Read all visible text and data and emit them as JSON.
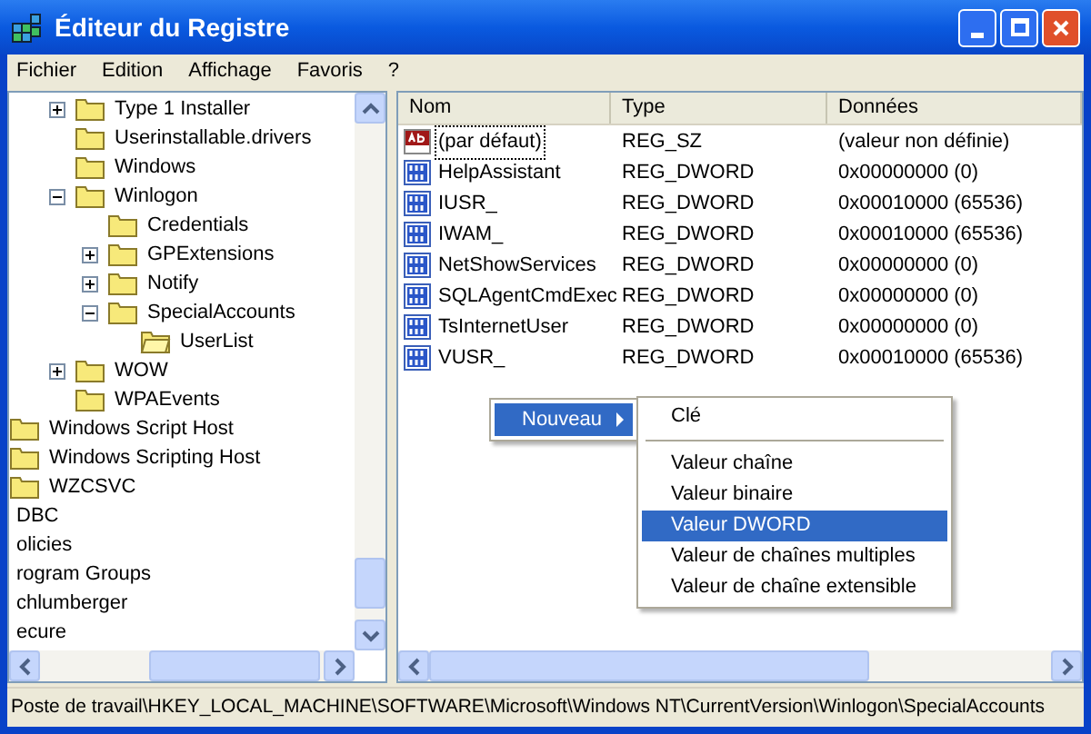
{
  "window": {
    "title": "Éditeur du Registre"
  },
  "menu_bar": [
    "Fichier",
    "Edition",
    "Affichage",
    "Favoris",
    "?"
  ],
  "tree": {
    "nodes": [
      {
        "children": [
          {
            "children": [
              {
                "children": [
                  {
                    "label": "Type 1 Installer",
                    "expanded": false,
                    "selected": false
                  },
                  {
                    "label": "Userinstallable.drivers",
                    "selected": false
                  },
                  {
                    "label": "Windows",
                    "selected": false
                  },
                  {
                    "label": "Winlogon",
                    "expanded": true,
                    "selected": false,
                    "children": [
                      {
                        "label": "Credentials",
                        "selected": false
                      },
                      {
                        "label": "GPExtensions",
                        "expanded": false,
                        "selected": false
                      },
                      {
                        "label": "Notify",
                        "expanded": false,
                        "selected": false
                      },
                      {
                        "label": "SpecialAccounts",
                        "expanded": true,
                        "selected": false,
                        "children": [
                          {
                            "label": "UserList",
                            "selected": true
                          }
                        ]
                      }
                    ]
                  },
                  {
                    "label": "WOW",
                    "expanded": false,
                    "selected": false
                  },
                  {
                    "label": "WPAEvents",
                    "selected": false
                  }
                ]
              }
            ]
          },
          {
            "label": "Windows Script Host",
            "selected": false
          },
          {
            "label": "Windows Scripting Host",
            "selected": false
          },
          {
            "label": "WZCSVC",
            "selected": false
          }
        ]
      },
      {
        "label": "DBC"
      },
      {
        "label": "olicies"
      },
      {
        "label": "rogram Groups"
      },
      {
        "label": "chlumberger"
      },
      {
        "label": "ecure"
      }
    ]
  },
  "values": {
    "columns": [
      "Nom",
      "Type",
      "Données"
    ],
    "rows": [
      {
        "kind": "string",
        "name": "(par défaut)",
        "type": "REG_SZ",
        "data": "(valeur non définie)",
        "focused": true
      },
      {
        "kind": "dword",
        "name": "HelpAssistant",
        "type": "REG_DWORD",
        "data": "0x00000000 (0)",
        "focused": false
      },
      {
        "kind": "dword",
        "name": "IUSR_",
        "type": "REG_DWORD",
        "data": "0x00010000 (65536)",
        "focused": false
      },
      {
        "kind": "dword",
        "name": "IWAM_",
        "type": "REG_DWORD",
        "data": "0x00010000 (65536)",
        "focused": false
      },
      {
        "kind": "dword",
        "name": "NetShowServices",
        "type": "REG_DWORD",
        "data": "0x00000000 (0)",
        "focused": false
      },
      {
        "kind": "dword",
        "name": "SQLAgentCmdExec",
        "type": "REG_DWORD",
        "data": "0x00000000 (0)",
        "focused": false
      },
      {
        "kind": "dword",
        "name": "TsInternetUser",
        "type": "REG_DWORD",
        "data": "0x00000000 (0)",
        "focused": false
      },
      {
        "kind": "dword",
        "name": "VUSR_",
        "type": "REG_DWORD",
        "data": "0x00010000 (65536)",
        "focused": false
      }
    ]
  },
  "context_menu": {
    "items": [
      {
        "label": "Nouveau",
        "selected": true,
        "submenu": true
      }
    ],
    "submenu": [
      {
        "kind": "item",
        "label": "Clé",
        "selected": false
      },
      {
        "kind": "separator"
      },
      {
        "kind": "item",
        "label": "Valeur chaîne",
        "selected": false
      },
      {
        "kind": "item",
        "label": "Valeur binaire",
        "selected": false
      },
      {
        "kind": "item",
        "label": "Valeur DWORD",
        "selected": true
      },
      {
        "kind": "item",
        "label": "Valeur de chaînes multiples",
        "selected": false
      },
      {
        "kind": "item",
        "label": "Valeur de chaîne extensible",
        "selected": false
      }
    ]
  },
  "status_bar": "Poste de travail\\HKEY_LOCAL_MACHINE\\SOFTWARE\\Microsoft\\Windows NT\\CurrentVersion\\Winlogon\\SpecialAccounts"
}
